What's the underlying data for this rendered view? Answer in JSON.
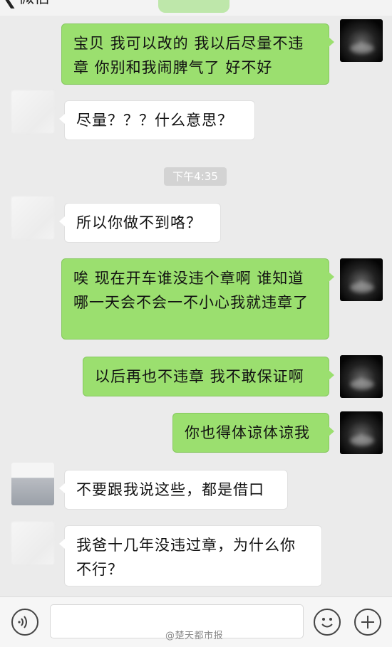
{
  "header": {
    "back_label": "微信"
  },
  "timestamp": "下午4:35",
  "messages": [
    {
      "side": "me",
      "text": "宝贝 我可以改的 我以后尽量不违章 你别和我闹脾气了 好不好"
    },
    {
      "side": "them",
      "text": "尽量？？？什么意思？"
    },
    {
      "side": "them",
      "text": "所以你做不到咯？"
    },
    {
      "side": "me",
      "text": "唉 现在开车谁没违个章啊 谁知道哪一天会不会一不小心我就违章了"
    },
    {
      "side": "me",
      "text": "以后再也不违章 我不敢保证啊"
    },
    {
      "side": "me",
      "text": "你也得体谅体谅我"
    },
    {
      "side": "them",
      "text": "不要跟我说这些，都是借口"
    },
    {
      "side": "them",
      "text": "我爸十几年没违过章，为什么你不行？"
    }
  ],
  "bottom": {
    "watermark": "@楚天都市报"
  },
  "colors": {
    "sent_bubble": "#9bdf6f",
    "received_bubble": "#ffffff",
    "background": "#ebebeb"
  },
  "icons": [
    "chevron-left-icon",
    "voice-icon",
    "emoji-icon",
    "plus-icon"
  ]
}
